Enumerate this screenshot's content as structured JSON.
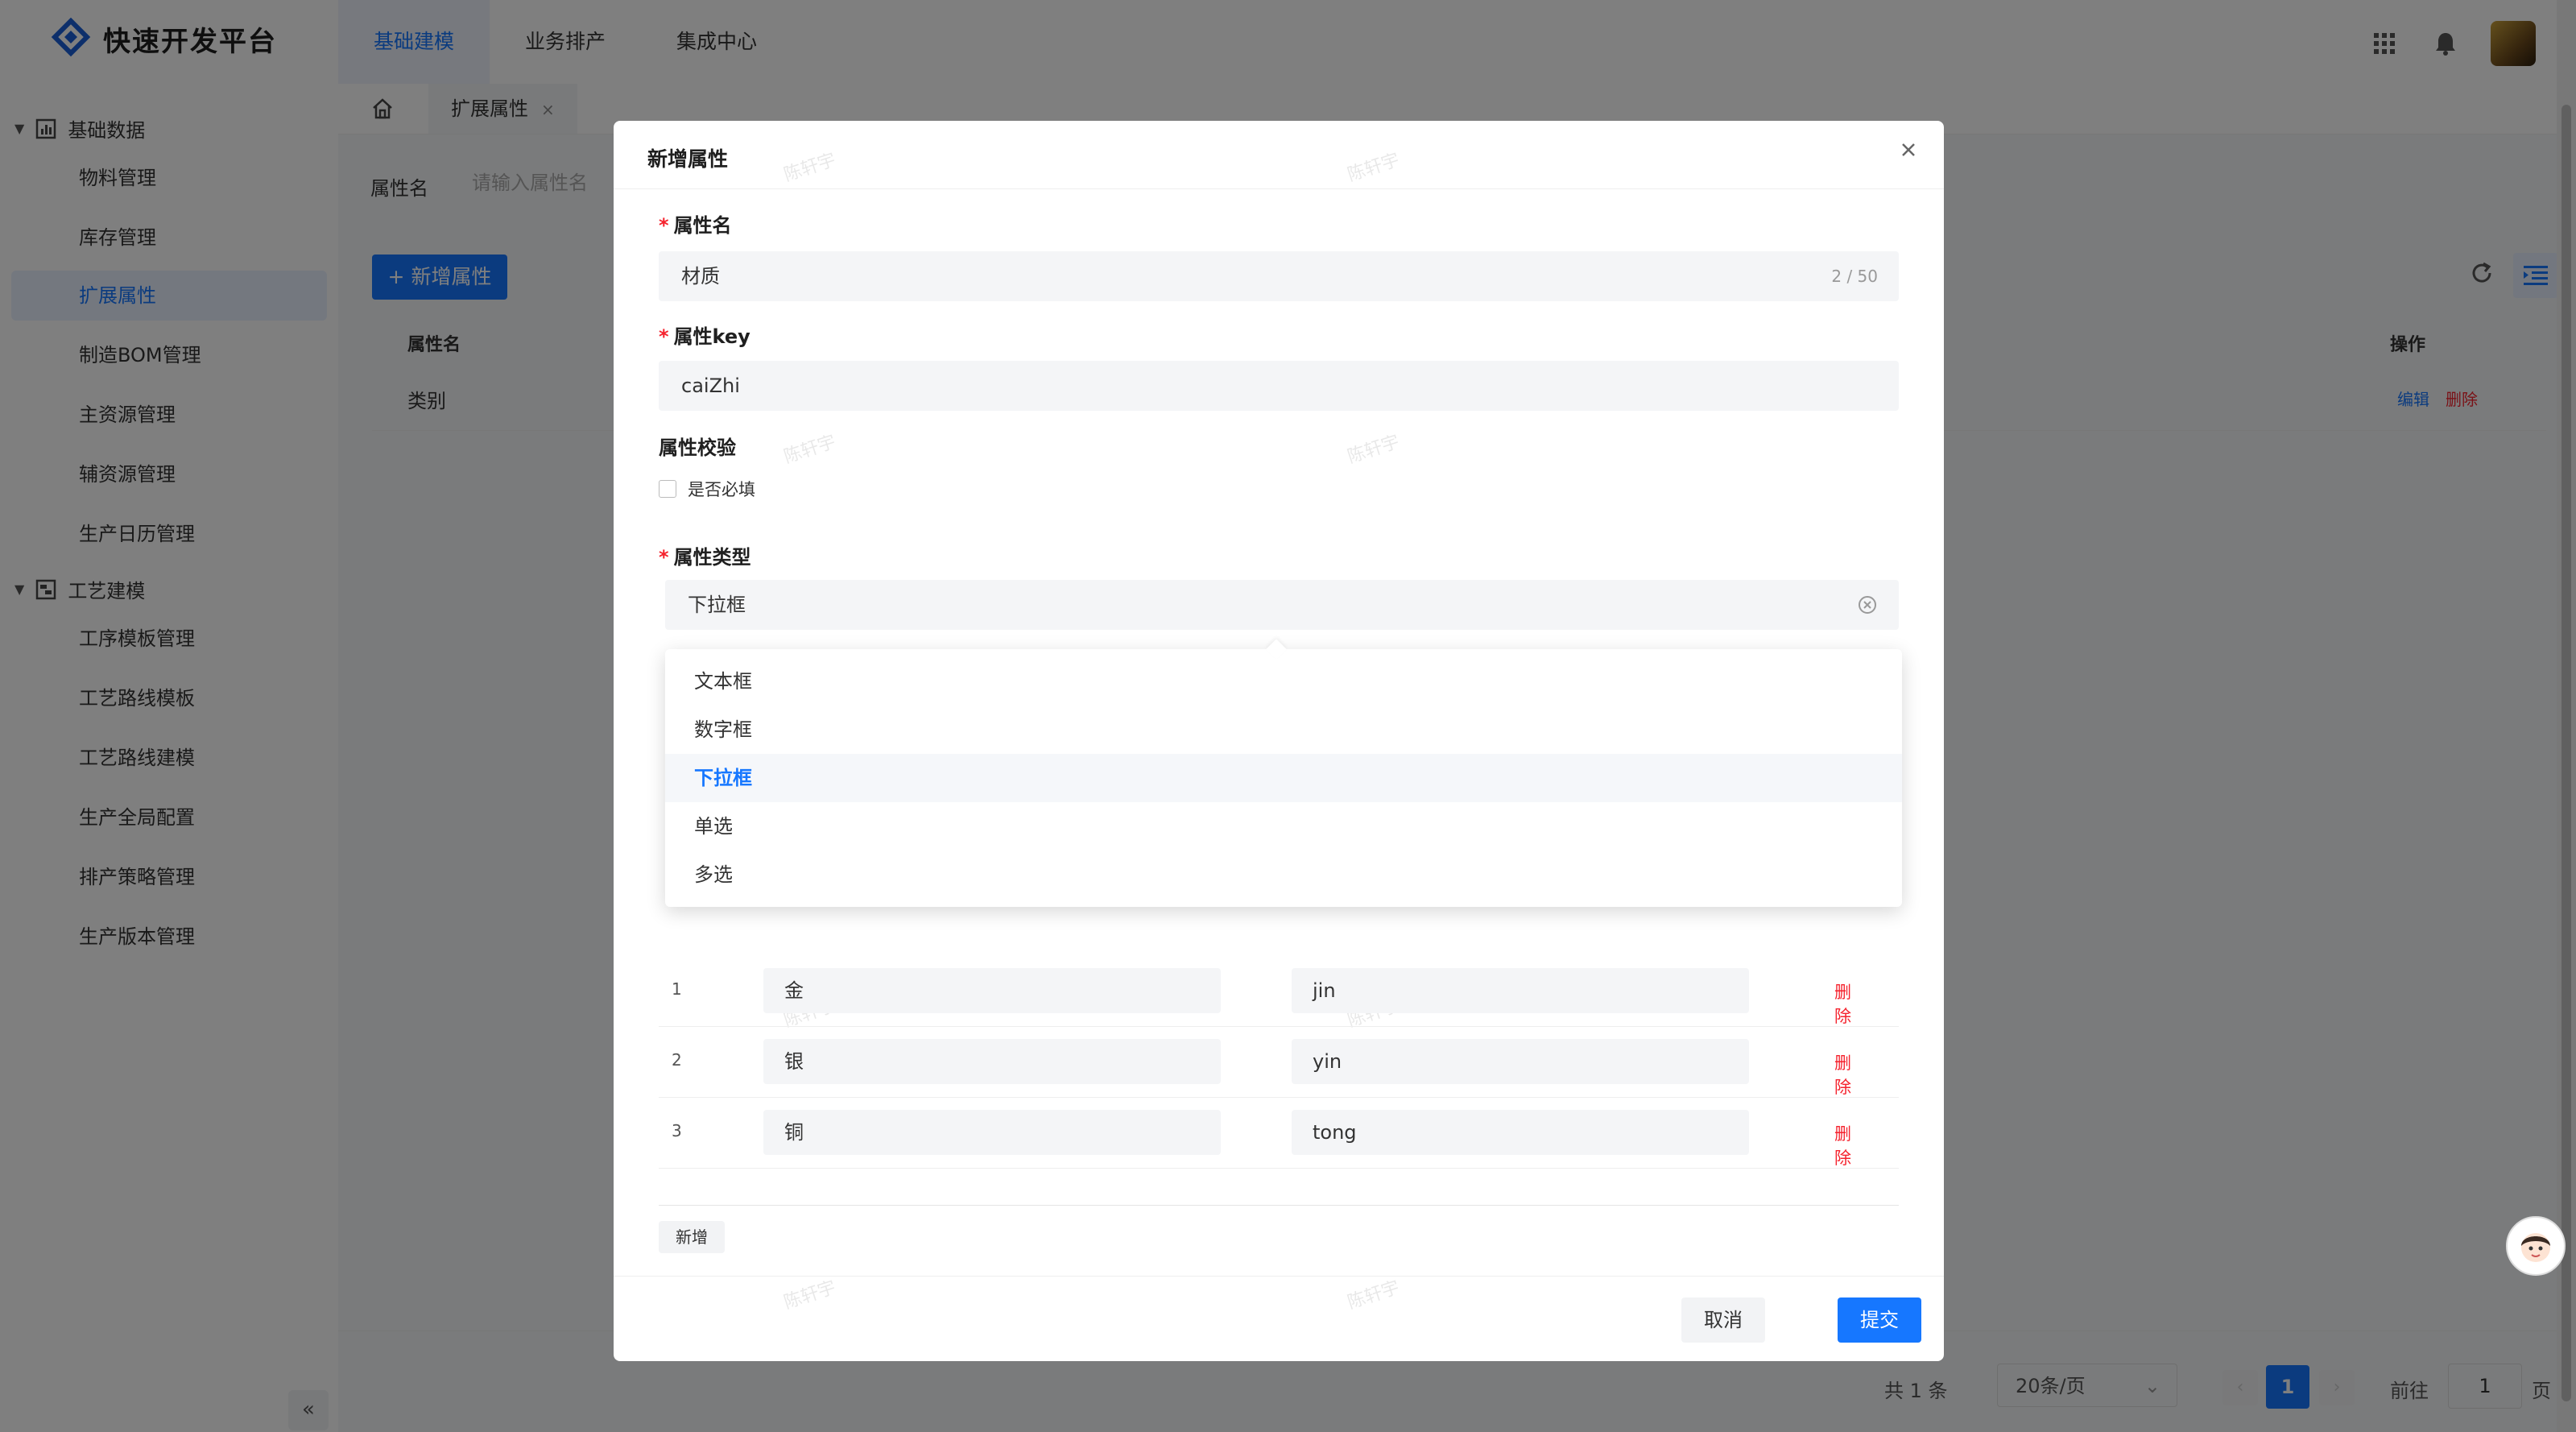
{
  "app": {
    "logo_text": "快速开发平台",
    "top_nav": [
      "基础建模",
      "业务排产",
      "集成中心"
    ],
    "active_top_nav": "基础建模"
  },
  "sidebar": {
    "groups": [
      {
        "label": "基础数据",
        "items": [
          "物料管理",
          "库存管理",
          "扩展属性",
          "制造BOM管理",
          "主资源管理",
          "辅资源管理",
          "生产日历管理"
        ]
      },
      {
        "label": "工艺建模",
        "items": [
          "工序模板管理",
          "工艺路线模板",
          "工艺路线建模",
          "生产全局配置",
          "排产策略管理",
          "生产版本管理"
        ]
      }
    ],
    "active_item": "扩展属性",
    "collapse_label": "«"
  },
  "page_tab": {
    "label": "扩展属性",
    "close": "×"
  },
  "search": {
    "label": "属性名",
    "placeholder": "请输入属性名"
  },
  "toolbar": {
    "add_label": "+ 新增属性"
  },
  "table": {
    "headers": [
      "属性名",
      "操作"
    ],
    "rows": [
      {
        "name": "类别",
        "edit": "编辑",
        "delete": "删除"
      }
    ]
  },
  "pagination": {
    "total": "共 1 条",
    "page_size": "20条/页",
    "prev": "‹",
    "current": "1",
    "next": "›",
    "goto_label": "前往",
    "goto_value": "1",
    "goto_unit": "页"
  },
  "modal": {
    "title": "新增属性",
    "watermark": "陈轩宇",
    "fields": {
      "name": {
        "label": "属性名",
        "value": "材质",
        "counter": "2 / 50"
      },
      "key": {
        "label": "属性key",
        "value": "caiZhi"
      },
      "validation": {
        "label": "属性校验",
        "checkbox": "是否必填",
        "checked": false
      },
      "type": {
        "label": "属性类型",
        "value": "下拉框"
      }
    },
    "dropdown_options": [
      "文本框",
      "数字框",
      "下拉框",
      "单选",
      "多选"
    ],
    "selected_option": "下拉框",
    "option_rows": [
      {
        "index": "1",
        "label": "金",
        "value": "jin",
        "delete": "删除"
      },
      {
        "index": "2",
        "label": "银",
        "value": "yin",
        "delete": "删除"
      },
      {
        "index": "3",
        "label": "铜",
        "value": "tong",
        "delete": "删除"
      }
    ],
    "add_row_label": "新增",
    "cancel_label": "取消",
    "submit_label": "提交"
  },
  "colors": {
    "primary": "#1677ff",
    "danger": "#f5222d",
    "mask": "rgba(0,0,0,0.5)"
  },
  "icons": [
    "logo-icon",
    "apps-grid-icon",
    "bell-icon",
    "avatar",
    "chart-icon",
    "process-icon",
    "home-icon",
    "refresh-icon",
    "column-settings-icon",
    "close-icon",
    "clear-icon",
    "assistant-icon"
  ]
}
